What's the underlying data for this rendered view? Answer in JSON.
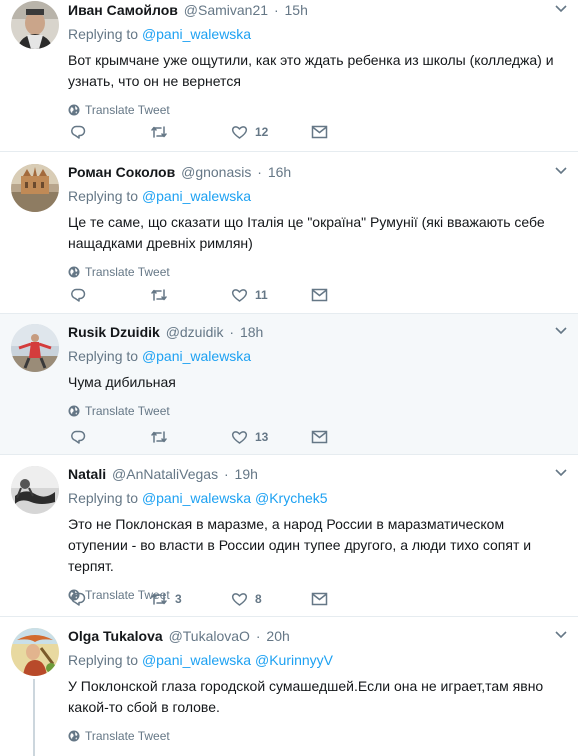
{
  "translate_label": "Translate Tweet",
  "replying_to_label": "Replying to",
  "tweets": [
    {
      "fullname": "Иван Самойлов",
      "username": "@Samivan21",
      "time": "15h",
      "mentions": [
        "@pani_walewska"
      ],
      "text": "Вот крымчане уже ощутили, как это ждать ребенка из школы (колледжа) и узнать, что он не вернется",
      "replies": "",
      "retweets": "",
      "likes": "12"
    },
    {
      "fullname": "Роман Соколов",
      "username": "@gnonasis",
      "time": "16h",
      "mentions": [
        "@pani_walewska"
      ],
      "text": "Це те саме, що сказати що Італія це \"окраїна\" Румунії (які вважають себе нащадками древніх римлян)",
      "replies": "",
      "retweets": "",
      "likes": "11"
    },
    {
      "fullname": "Rusik Dzuidik",
      "username": "@dzuidik",
      "time": "18h",
      "mentions": [
        "@pani_walewska"
      ],
      "text": "Чума дибильная",
      "replies": "",
      "retweets": "",
      "likes": "13"
    },
    {
      "fullname": "Natali",
      "username": "@AnNataliVegas",
      "time": "19h",
      "mentions": [
        "@pani_walewska",
        "@Krychek5"
      ],
      "text": "Это не Поклонская в маразме, а народ России в маразматическом отупении - во власти в России один тупее другого, а люди тихо сопят и терпят.",
      "replies": "",
      "retweets": "3",
      "likes": "8"
    },
    {
      "fullname": "Olga Tukalova",
      "username": "@TukalovaO",
      "time": "20h",
      "mentions": [
        "@pani_walewska",
        "@KurinnyyV"
      ],
      "text": "У Поклонской глаза городской сумашедшей.Если она не играет,там явно какой-то сбой в голове.",
      "replies": "",
      "retweets": "",
      "likes": ""
    }
  ]
}
